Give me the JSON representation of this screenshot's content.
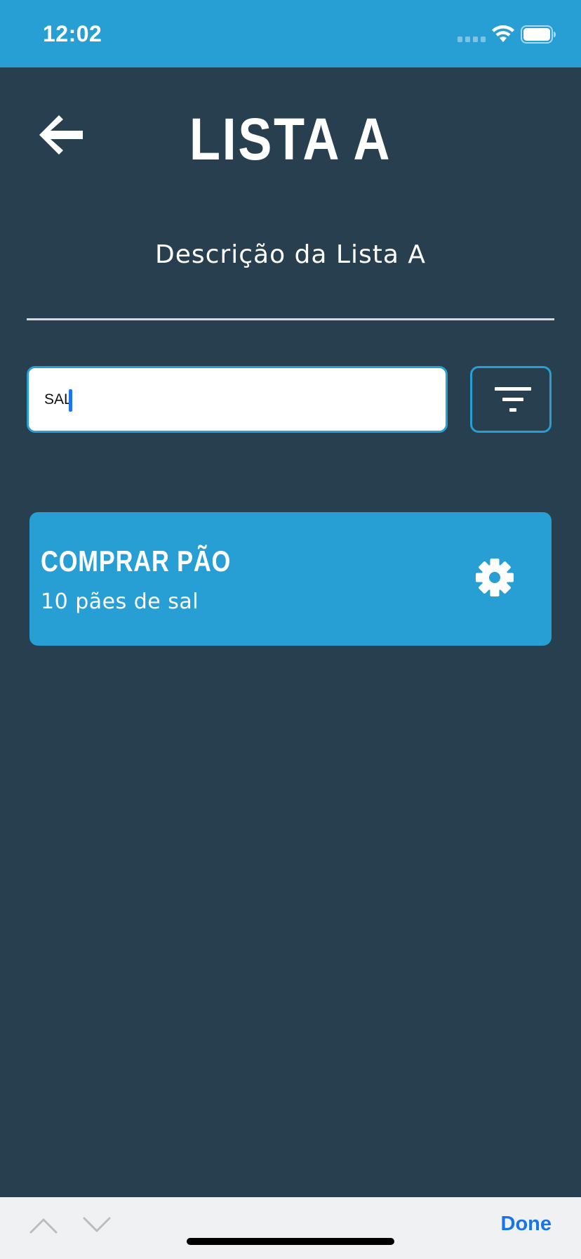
{
  "status_bar": {
    "time": "12:02",
    "background_color": "#279ed4",
    "icons": [
      "signal-icon",
      "wifi-icon",
      "battery-icon"
    ]
  },
  "header": {
    "back_icon": "arrow-left-icon",
    "title": "LISTA A",
    "description": "Descrição da Lista A"
  },
  "search": {
    "value": "SAL",
    "placeholder": ""
  },
  "filter": {
    "icon": "filter-icon"
  },
  "tasks": [
    {
      "title": "COMPRAR PÃO",
      "subtitle": "10 pães de sal",
      "settings_icon": "gear-icon"
    }
  ],
  "keyboard_toolbar": {
    "prev_icon": "chevron-up-icon",
    "next_icon": "chevron-down-icon",
    "done_label": "Done"
  },
  "colors": {
    "background": "#273f4e",
    "accent": "#279ed4",
    "done_text": "#1676e9"
  }
}
